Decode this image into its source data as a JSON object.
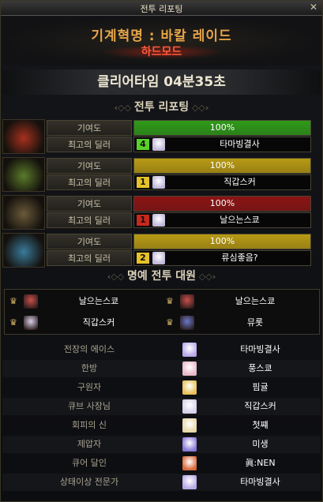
{
  "window": {
    "title": "전투 리포팅",
    "close_glyph": "✕"
  },
  "raid": {
    "name": "기계혁명 : 바칼 레이드",
    "mode": "하드모드"
  },
  "clear_time": "클리어타임  04분35초",
  "report_section": "전투 리포팅",
  "honor_section": "명예 전투 대원",
  "party_rows": [
    {
      "contrib_label": "기여도",
      "contrib_value": "100%",
      "contrib_fraction": 1.0,
      "bar_color": "#2f9a19",
      "dealer_label": "최고의 딜러",
      "dealer_badge": "4",
      "badge_color": "#5ad12a",
      "dealer_name": "타마빙결사",
      "tile_color": "#a6311e"
    },
    {
      "contrib_label": "기여도",
      "contrib_value": "100%",
      "contrib_fraction": 1.0,
      "bar_color": "#b79a14",
      "dealer_label": "최고의 딜러",
      "dealer_badge": "1",
      "badge_color": "#e6c22a",
      "dealer_name": "직갑스커",
      "tile_color": "#5b7a2a"
    },
    {
      "contrib_label": "기여도",
      "contrib_value": "100%",
      "contrib_fraction": 1.0,
      "bar_color": "#8c1414",
      "dealer_label": "최고의 딜러",
      "dealer_badge": "1",
      "badge_color": "#c8281e",
      "dealer_name": "날으는스쿄",
      "tile_color": "#6a5a3a"
    },
    {
      "contrib_label": "기여도",
      "contrib_value": "100%",
      "contrib_fraction": 1.0,
      "bar_color": "#b79a14",
      "dealer_label": "최고의 딜러",
      "dealer_badge": "2",
      "badge_color": "#e6c22a",
      "dealer_name": "류심좋음?",
      "tile_color": "#3a7a9a"
    }
  ],
  "honor_members": [
    {
      "name": "날으는스쿄",
      "avatar_color": "#c8504a"
    },
    {
      "name": "날으는스쿄",
      "avatar_color": "#c8504a"
    },
    {
      "name": "직갑스커",
      "avatar_color": "#d8d0e8"
    },
    {
      "name": "뮤롯",
      "avatar_color": "#6a7ac8"
    }
  ],
  "awards": [
    {
      "title": "전장의 에이스",
      "name": "타마빙결사",
      "avatar_color": "#b8a8e8"
    },
    {
      "title": "한방",
      "name": "풍스쿄",
      "avatar_color": "#e8b8c8"
    },
    {
      "title": "구원자",
      "name": "핌귤",
      "avatar_color": "#e8c058"
    },
    {
      "title": "큐브 사장님",
      "name": "직갑스커",
      "avatar_color": "#d8d0e8"
    },
    {
      "title": "회피의 신",
      "name": "첫쨰",
      "avatar_color": "#e8d8a8"
    },
    {
      "title": "제압자",
      "name": "미생",
      "avatar_color": "#8a7ad8"
    },
    {
      "title": "큐어 달인",
      "name": "眞:NEN",
      "avatar_color": "#d86a3a"
    },
    {
      "title": "상태이상 전문가",
      "name": "타마빙결사",
      "avatar_color": "#b8a8e8"
    }
  ]
}
